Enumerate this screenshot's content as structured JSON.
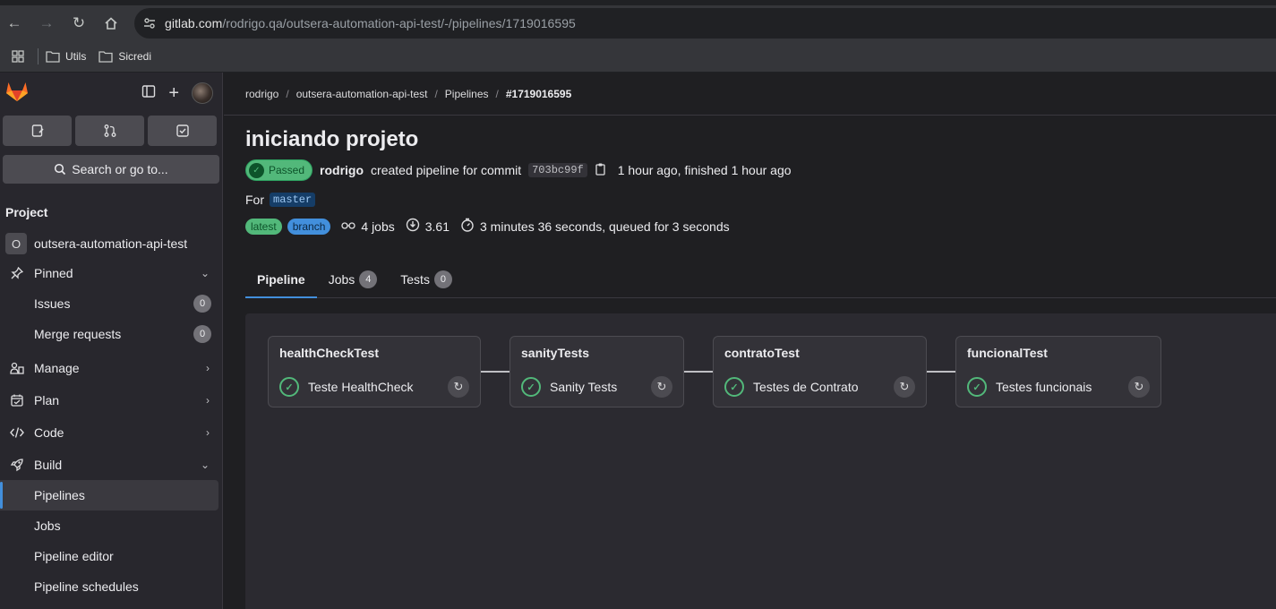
{
  "browser": {
    "url_host": "gitlab.com",
    "url_path": "/rodrigo.qa/outsera-automation-api-test/-/pipelines/1719016595",
    "bookmarks": [
      "Utils",
      "Sicredi"
    ]
  },
  "sidebar": {
    "search_label": "Search or go to...",
    "section_heading": "Project",
    "project_initial": "O",
    "project_name": "outsera-automation-api-test",
    "pinned_label": "Pinned",
    "issues_label": "Issues",
    "issues_count": "0",
    "merge_requests_label": "Merge requests",
    "merge_requests_count": "0",
    "manage_label": "Manage",
    "plan_label": "Plan",
    "code_label": "Code",
    "build_label": "Build",
    "build_items": [
      "Pipelines",
      "Jobs",
      "Pipeline editor",
      "Pipeline schedules"
    ]
  },
  "breadcrumb": [
    "rodrigo",
    "outsera-automation-api-test",
    "Pipelines",
    "#1719016595"
  ],
  "pipeline": {
    "title": "iniciando projeto",
    "status": "Passed",
    "author": "rodrigo",
    "action_text": "created pipeline for commit",
    "commit_sha": "703bc99f",
    "time_text": "1 hour ago, finished 1 hour ago",
    "for_label": "For",
    "branch": "master",
    "tags": [
      "latest",
      "branch"
    ],
    "jobs_text": "4 jobs",
    "score": "3.61",
    "duration_text": "3 minutes 36 seconds, queued for 3 seconds"
  },
  "tabs": [
    {
      "label": "Pipeline",
      "count": null
    },
    {
      "label": "Jobs",
      "count": "4"
    },
    {
      "label": "Tests",
      "count": "0"
    }
  ],
  "stages": [
    {
      "name": "healthCheckTest",
      "job": "Teste HealthCheck",
      "status": "success"
    },
    {
      "name": "sanityTests",
      "job": "Sanity Tests",
      "status": "success"
    },
    {
      "name": "contratoTest",
      "job": "Testes de Contrato",
      "status": "success"
    },
    {
      "name": "funcionalTest",
      "job": "Testes funcionais",
      "status": "success"
    }
  ],
  "colors": {
    "success": "#52b87a",
    "accent": "#428fdc",
    "background": "#1f1f22"
  }
}
